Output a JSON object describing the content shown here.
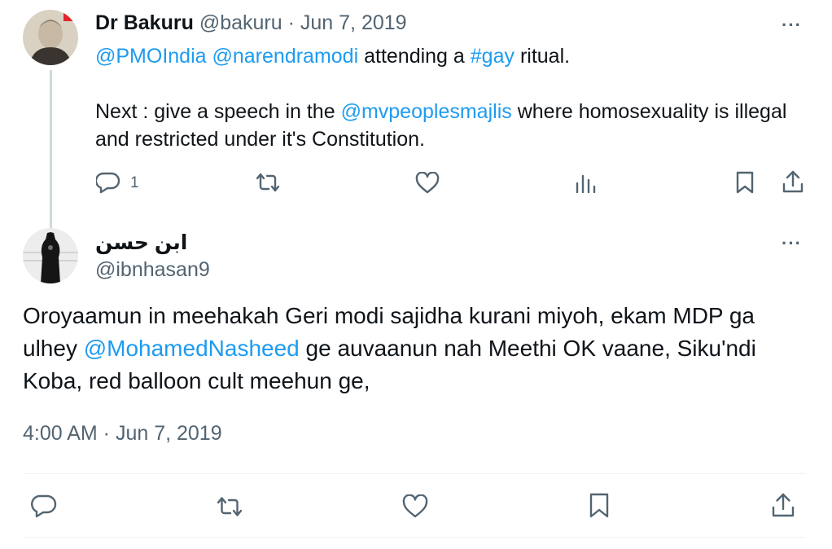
{
  "parent_tweet": {
    "author_name": "Dr Bakuru",
    "handle": "@bakuru",
    "separator": "·",
    "date": "Jun 7, 2019",
    "mention1": "@PMOIndia",
    "mention2": "@narendramodi",
    "text_part1": "attending a",
    "hashtag": "#gay",
    "text_part2": "ritual.",
    "line2_pre": "Next : give a speech in the",
    "line2_mention": "@mvpeoplesmajlis",
    "line2_post": "where homosexuality is illegal and restricted under it's Constitution.",
    "reply_count": "1",
    "more": "···"
  },
  "main_tweet": {
    "author_name": "ابن حسن",
    "handle": "@ibnhasan9",
    "more": "···",
    "text_pre": "Oroyaamun in meehakah Geri modi sajidha kurani miyoh, ekam MDP ga ulhey",
    "text_mention": "@MohamedNasheed",
    "text_post": "ge auvaanun nah Meethi OK vaane, Siku'ndi Koba, red balloon cult meehun ge,",
    "timestamp": "4:00 AM · Jun 7, 2019"
  },
  "icons": {
    "reply": "reply-icon",
    "retweet": "retweet-icon",
    "like": "like-icon",
    "views": "views-icon",
    "bookmark": "bookmark-icon",
    "share": "share-icon"
  },
  "colors": {
    "link": "#1d9bf0",
    "muted": "#536471",
    "text": "#0f1419",
    "thread_line": "#cfd9de",
    "divider": "#eff3f4"
  }
}
